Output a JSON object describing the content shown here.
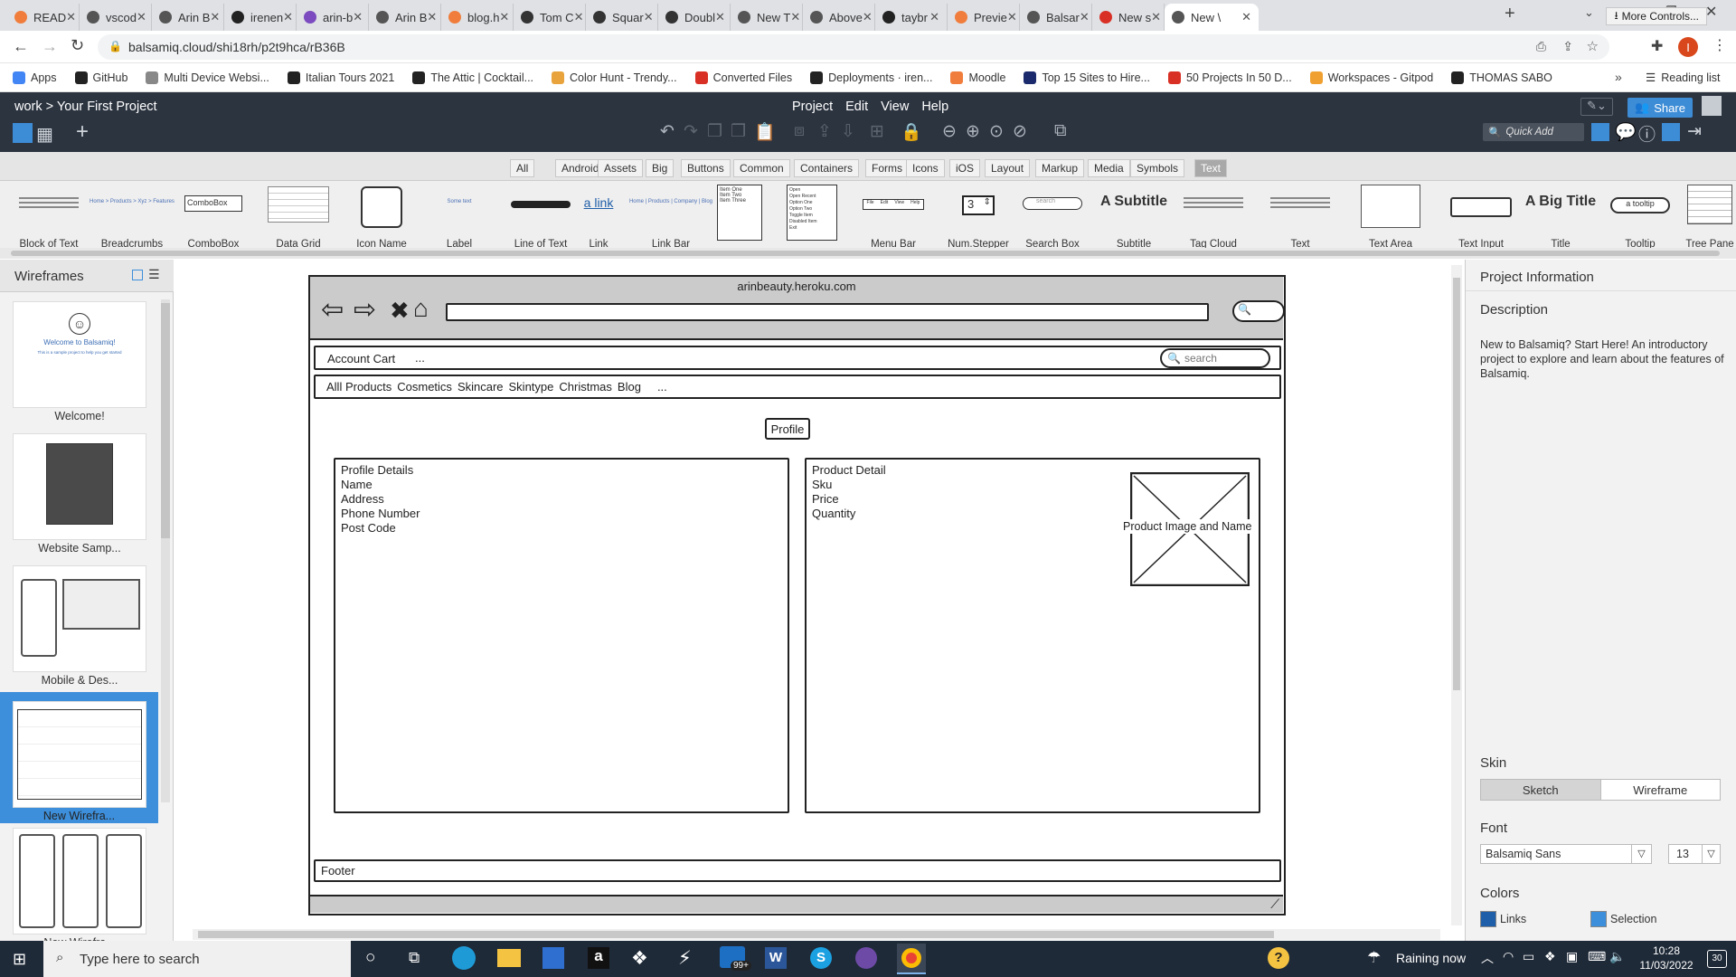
{
  "browser": {
    "tabs": [
      {
        "label": "READ",
        "color": "#f07d3c"
      },
      {
        "label": "vscod",
        "color": "#555"
      },
      {
        "label": "Arin B",
        "color": "#555"
      },
      {
        "label": "irenen",
        "color": "#222"
      },
      {
        "label": "arin-b",
        "color": "#7b4bbf"
      },
      {
        "label": "Arin B",
        "color": "#555"
      },
      {
        "label": "blog.h",
        "color": "#f07d3c"
      },
      {
        "label": "Tom C",
        "color": "#333"
      },
      {
        "label": "Squar",
        "color": "#333"
      },
      {
        "label": "Doubl",
        "color": "#333"
      },
      {
        "label": "New T",
        "color": "#555"
      },
      {
        "label": "Above",
        "color": "#555"
      },
      {
        "label": "taybr",
        "color": "#222"
      },
      {
        "label": "Previe",
        "color": "#f07d3c"
      },
      {
        "label": "Balsar",
        "color": "#555"
      },
      {
        "label": "New s",
        "color": "#d93025"
      },
      {
        "label": "New \\",
        "color": "#555"
      }
    ],
    "url": "balsamiq.cloud/shi18rh/p2t9hca/rB36B",
    "bookmarks": [
      {
        "label": "Apps",
        "color": "#4285f4"
      },
      {
        "label": "GitHub",
        "color": "#222"
      },
      {
        "label": "Multi Device Websi...",
        "color": "#888"
      },
      {
        "label": "Italian Tours 2021",
        "color": "#222"
      },
      {
        "label": "The Attic | Cocktail...",
        "color": "#222"
      },
      {
        "label": "Color Hunt - Trendy...",
        "color": "#e8a33c"
      },
      {
        "label": "Converted Files",
        "color": "#d93025"
      },
      {
        "label": "Deployments · iren...",
        "color": "#222"
      },
      {
        "label": "Moodle",
        "color": "#f07d3c"
      },
      {
        "label": "Top 15 Sites to Hire...",
        "color": "#1a2a6c"
      },
      {
        "label": "50 Projects In 50 D...",
        "color": "#d93025"
      },
      {
        "label": "Workspaces - Gitpod",
        "color": "#f0a030"
      },
      {
        "label": "THOMAS SABO",
        "color": "#222"
      }
    ],
    "reading_list": "Reading list"
  },
  "app": {
    "breadcrumb": "work > Your First Project",
    "menus": [
      "Project",
      "Edit",
      "View",
      "Help"
    ],
    "share": "Share",
    "quick_add": "Quick Add"
  },
  "library_tabs": [
    "All",
    "Android",
    "Assets",
    "Big",
    "Buttons",
    "Common",
    "Containers",
    "Forms",
    "Icons",
    "iOS",
    "Layout",
    "Markup",
    "Media",
    "Symbols",
    "Text"
  ],
  "library_tab_selected": "Text",
  "more_controls": "More Controls...",
  "library_items": [
    {
      "label": "Block of Text",
      "kind": "lines"
    },
    {
      "label": "Breadcrumbs",
      "kind": "text",
      "sample": "Home > Products > Xyz > Features"
    },
    {
      "label": "ComboBox",
      "kind": "combo",
      "sample": "ComboBox"
    },
    {
      "label": "Data Grid",
      "kind": "grid"
    },
    {
      "label": "Icon Name",
      "kind": "iconname"
    },
    {
      "label": "Label",
      "kind": "text",
      "sample": "Some text"
    },
    {
      "label": "Line of Text",
      "kind": "scribble"
    },
    {
      "label": "Link",
      "kind": "link",
      "sample": "a link"
    },
    {
      "label": "Link Bar",
      "kind": "text",
      "sample": "Home | Products | Company | Blog"
    },
    {
      "label": "",
      "kind": "list",
      "items": [
        "Item One",
        "Item Two",
        "Item Three"
      ]
    },
    {
      "label": "",
      "kind": "menu",
      "items": [
        "Open",
        "Open Recent",
        "Option One",
        "Option Two",
        "Toggle Item",
        "Disabled Item",
        "Exit"
      ]
    },
    {
      "label": "Menu Bar",
      "kind": "menubar",
      "items": [
        "File",
        "Edit",
        "View",
        "Help"
      ]
    },
    {
      "label": "Num.Stepper",
      "kind": "stepper",
      "sample": "3"
    },
    {
      "label": "Search Box",
      "kind": "search",
      "sample": "search"
    },
    {
      "label": "Subtitle",
      "kind": "subtitle",
      "sample": "A Subtitle"
    },
    {
      "label": "Tag Cloud",
      "kind": "lines"
    },
    {
      "label": "Text",
      "kind": "lines"
    },
    {
      "label": "Text Area",
      "kind": "textarea"
    },
    {
      "label": "Text Input",
      "kind": "input"
    },
    {
      "label": "Title",
      "kind": "title",
      "sample": "A Big Title"
    },
    {
      "label": "Tooltip",
      "kind": "tooltip",
      "sample": "a tooltip"
    },
    {
      "label": "Tree Pane",
      "kind": "tree"
    }
  ],
  "wireframes_panel": {
    "title": "Wireframes",
    "pages": [
      {
        "label": "Welcome!",
        "thumb_title": "Welcome to Balsamiq!",
        "thumb_sub": "This is a sample project to help you get started"
      },
      {
        "label": "Website Samp...",
        "thumb_title": "",
        "thumb_sub": ""
      },
      {
        "label": "Mobile & Des...",
        "thumb_title": "",
        "thumb_sub": ""
      },
      {
        "label": "New Wirefra...",
        "thumb_title": "",
        "thumb_sub": "",
        "selected": true
      },
      {
        "label": "New Wirefra...",
        "thumb_title": "",
        "thumb_sub": ""
      }
    ]
  },
  "wireframe": {
    "url": "arinbeauty.heroku.com",
    "nav1": "Account Cart",
    "nav1_more": "...",
    "search_placeholder": "search",
    "nav2": [
      "Alll Products",
      "Cosmetics",
      "Skincare",
      "Skintype",
      "Christmas",
      "Blog"
    ],
    "nav2_more": "...",
    "profile_button": "Profile",
    "profile_panel": [
      "Profile Details",
      "Name",
      "Address",
      "Phone Number",
      "Post Code"
    ],
    "product_panel": [
      "Product Detail",
      "Sku",
      "Price",
      "Quantity"
    ],
    "product_image_label": "Product Image and Name",
    "footer": "Footer"
  },
  "properties": {
    "title": "Project Information",
    "description_label": "Description",
    "description": "New to Balsamiq? Start Here! An introductory project to explore and learn about the features of Balsamiq.",
    "skin_label": "Skin",
    "skin_options": [
      "Sketch",
      "Wireframe"
    ],
    "skin_selected": "Sketch",
    "font_label": "Font",
    "font_value": "Balsamiq Sans",
    "font_size": "13",
    "colors_label": "Colors",
    "colors": [
      {
        "label": "Links",
        "hex": "#1f5ea8"
      },
      {
        "label": "Selection",
        "hex": "#3d8fdb"
      }
    ]
  },
  "taskbar": {
    "search_placeholder": "Type here to search",
    "weather": "Raining now",
    "time": "10:28",
    "date": "11/03/2022",
    "notif_count": "30",
    "mail_badge": "99+"
  }
}
